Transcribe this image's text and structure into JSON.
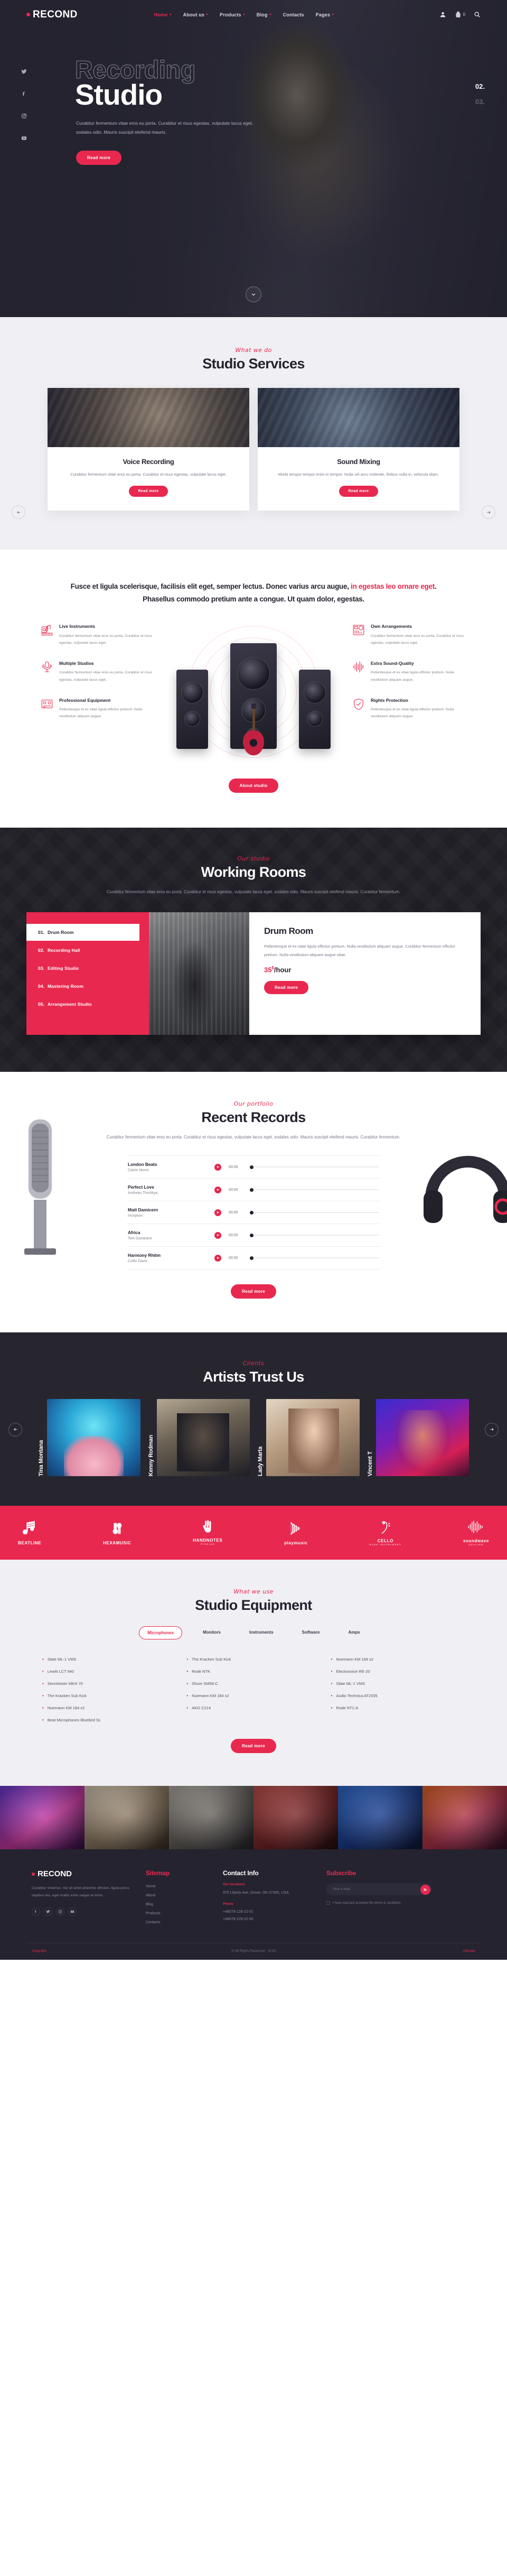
{
  "brand": {
    "name": "RECOND"
  },
  "nav": {
    "items": [
      {
        "label": "Home",
        "active": true,
        "caret": true
      },
      {
        "label": "About us",
        "active": false,
        "caret": true
      },
      {
        "label": "Products",
        "active": false,
        "caret": true
      },
      {
        "label": "Blog",
        "active": false,
        "caret": true
      },
      {
        "label": "Contacts",
        "active": false,
        "caret": false
      },
      {
        "label": "Pages",
        "active": false,
        "caret": true
      }
    ],
    "cart_count": "0",
    "icons": [
      "user-icon",
      "cart-icon",
      "search-icon"
    ]
  },
  "hero": {
    "title_outline": "Recording",
    "title_solid": "Studio",
    "description": "Curabitur fermentum vitae eros eu porta. Curabitur et risus egestas, vulputate lacus eget, sodales odio. Mauris suscipit eleifend mauris.",
    "button": "Read more",
    "socials": [
      "twitter-icon",
      "facebook-icon",
      "instagram-icon",
      "youtube-icon"
    ],
    "counter": {
      "current": "02.",
      "next": "03."
    }
  },
  "services": {
    "kicker": "What we do",
    "title": "Studio Services",
    "cards": [
      {
        "title": "Voice Recording",
        "text": "Curabitur fermentum vitae eros eu porta. Curabitur et risus egestas, vulputate lacus eget.",
        "button": "Read more"
      },
      {
        "title": "Sound Mixing",
        "text": "Morbi tempor tempor enim in tempor. Nulla vel arcu molestie, finibus nulla in, vehicula diam.",
        "button": "Read more"
      }
    ]
  },
  "features": {
    "headline_1": "Fusce et ligula scelerisque, facilisis elit eget, semper lectus. Donec varius arcu augue, ",
    "headline_highlight": "in egestas leo ornare eget",
    "headline_2": ". Phasellus commodo pretium ante a congue. Ut quam dolor, egestas.",
    "left": [
      {
        "icon": "live-instruments-icon",
        "name": "Live Instruments",
        "text": "Curabitur fermentum vitae eros eu porta. Curabitur et risus egestas, vulputate lacus eget."
      },
      {
        "icon": "microphone-icon",
        "name": "Multiple Studios",
        "text": "Curabitur fermentum vitae eros eu porta. Curabitur et risus egestas, vulputate lacus eget."
      },
      {
        "icon": "professional-equipment-icon",
        "name": "Professional Equipment",
        "text": "Pellentesque et ex vitae ligula efficitur pretium. Nulla vestibulum aliquam augue."
      }
    ],
    "right": [
      {
        "icon": "mixer-icon",
        "name": "Own Arrangements",
        "text": "Curabitur fermentum vitae eros eu porta. Curabitur et risus egestas, vulputate lacus eget."
      },
      {
        "icon": "sound-wave-icon",
        "name": "Extra Sound-Quality",
        "text": "Pellentesque et ex vitae ligula efficitur pretium. Nulla vestibulum aliquam augue."
      },
      {
        "icon": "shield-icon",
        "name": "Rights Protection",
        "text": "Pellentesque et ex vitae ligula efficitur pretium. Nulla vestibulum aliquam augue."
      }
    ],
    "button": "About studio"
  },
  "rooms": {
    "kicker": "Our studio",
    "title": "Working Rooms",
    "description": "Curabitur fermentum vitae eros eu porta. Curabitur et risus egestas, vulputate lacus eget, sodales odio. Mauris suscipit eleifend mauris. Curabitur fermentum.",
    "tabs": [
      {
        "num": "01.",
        "label": "Drum Room",
        "active": true
      },
      {
        "num": "02.",
        "label": "Recording Hall",
        "active": false
      },
      {
        "num": "03.",
        "label": "Editing Studio",
        "active": false
      },
      {
        "num": "04.",
        "label": "Mastering Room",
        "active": false
      },
      {
        "num": "05.",
        "label": "Arrangement Studio",
        "active": false
      }
    ],
    "detail": {
      "title": "Drum Room",
      "text": "Pellentesque et ex vitae ligula efficitur pretium. Nulla vestibulum aliquam augue. Curabitur fermentum efficitur pretium. Nulla vestibulum aliquam augue vitae.",
      "price_amount": "35",
      "price_currency": "$",
      "price_unit": "/hour",
      "button": "Read more"
    }
  },
  "records": {
    "kicker": "Our portfolio",
    "title": "Recent Records",
    "description": "Curabitur fermentum vitae eros eu porta. Curabitur et risus egestas, vulputate lacus eget, sodales odio. Mauris suscipit eleifend mauris. Curabitur fermentum.",
    "tracks": [
      {
        "name": "London Beats",
        "artist": "Calvin Norris",
        "time": "00:00"
      },
      {
        "name": "Perfect Love",
        "artist": "Andreas Thonikya",
        "time": "00:00"
      },
      {
        "name": "Matt Damicern",
        "artist": "Inception",
        "time": "00:00"
      },
      {
        "name": "Africa",
        "artist": "Tom Ganarace",
        "time": "00:00"
      },
      {
        "name": "Harmony Rhitm",
        "artist": "Collin Davis",
        "time": "00:00"
      }
    ],
    "button": "Read more"
  },
  "artists": {
    "kicker": "Clients",
    "title": "Artists Trust Us",
    "cards": [
      {
        "name": "Tina Montana"
      },
      {
        "name": "Kenny Rodman"
      },
      {
        "name": "Lady Marta"
      },
      {
        "name": "Vincent T"
      }
    ]
  },
  "brands": [
    {
      "name": "BEATLINE",
      "sub": "",
      "icon": "beatline-logo"
    },
    {
      "name": "HEXAMUSIC",
      "sub": "",
      "icon": "hexamusic-logo"
    },
    {
      "name": "HANDNOTES",
      "sub": "Premium",
      "icon": "handnotes-logo"
    },
    {
      "name": "playmusic",
      "sub": "",
      "icon": "playmusic-logo"
    },
    {
      "name": "CELLO",
      "sub": "BASS INSTRUMENT",
      "icon": "cello-logo"
    },
    {
      "name": "soundwave",
      "sub": "DEALING",
      "icon": "soundwave-logo"
    }
  ],
  "equipment": {
    "kicker": "What we use",
    "title": "Studio Equipment",
    "tabs": [
      {
        "label": "Microphones",
        "active": true
      },
      {
        "label": "Monitors",
        "active": false
      },
      {
        "label": "Instruments",
        "active": false
      },
      {
        "label": "Software",
        "active": false
      },
      {
        "label": "Amps",
        "active": false
      }
    ],
    "columns": [
      [
        "Slate ML-1 VMS",
        "Lewitt LCT 940",
        "Sennheiser MKH 70",
        "The Kracken Sub Kick",
        "Nuemann KM 184 x2",
        "Beat Microphones Bluebird SL"
      ],
      [
        "The Kracken Sub Kick",
        "Rode NTK",
        "Shure SM58-C",
        "Nuemann KM 184 x2",
        "AKG C214",
        ""
      ],
      [
        "Nuemann KM 184 x2",
        "Electrovoice RE-20",
        "Slate ML-1 VMS",
        "Audio Technica AT2035",
        "Rode NT1-A",
        ""
      ]
    ],
    "button": "Read more"
  },
  "footer": {
    "brand": "RECOND",
    "about": "Curabitur vivamus, nisi sit amet pharetra ultricies, ligula purus dapibus leo, eget mattis enim neque at tortor.",
    "socials": [
      "facebook-icon",
      "twitter-icon",
      "instagram-icon",
      "youtube-icon"
    ],
    "sitemap": {
      "title": "Sitemap",
      "items": [
        "Home",
        "About",
        "Blog",
        "Products",
        "Contacts"
      ]
    },
    "contacts": {
      "title": "Contact Info",
      "address_label": "Our locations",
      "address": "970 Liberty Ave, Grove, OK 07305, USA",
      "phone_label": "Phone",
      "phones": [
        "+48078-128-22-51",
        "+48078-128-22-50"
      ]
    },
    "subscribe": {
      "title": "Subscribe",
      "placeholder": "Your e-mail",
      "button_icon": "send-icon",
      "checkbox_text": "I have read and accepted the terms & conditions"
    },
    "copyright_1": "Copyright",
    "copyright_2": "© All Rights Reserved - 2019 -",
    "copyright_3": "Ultimate"
  },
  "colors": {
    "accent": "#e8284f",
    "dark": "#24232f",
    "light": "#f0eff3"
  }
}
